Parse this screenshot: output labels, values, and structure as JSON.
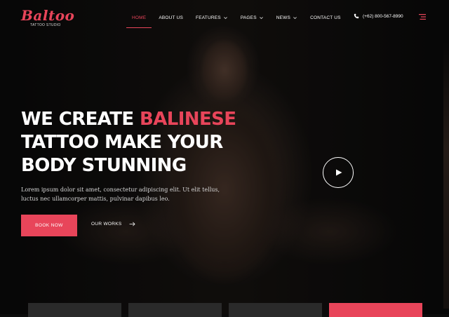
{
  "logo": {
    "title": "Baltoo",
    "subtitle": "TATTOO STUDIO"
  },
  "nav": {
    "items": [
      {
        "label": "HOME",
        "active": true,
        "dropdown": false
      },
      {
        "label": "ABOUT US",
        "active": false,
        "dropdown": false
      },
      {
        "label": "FEATURES",
        "active": false,
        "dropdown": true
      },
      {
        "label": "PAGES",
        "active": false,
        "dropdown": true
      },
      {
        "label": "NEWS",
        "active": false,
        "dropdown": true
      },
      {
        "label": "CONTACT US",
        "active": false,
        "dropdown": false
      }
    ]
  },
  "contact": {
    "phone": "(+62) 800-567-8990",
    "icon": "phone-icon"
  },
  "hero": {
    "headline_part1": "WE CREATE ",
    "headline_accent": "BALINESE",
    "headline_line2": "TATTOO MAKE YOUR",
    "headline_line3": "BODY STUNNING",
    "description": "Lorem ipsum dolor sit amet, consectetur adipiscing elit. Ut elit tellus, luctus nec ullamcorper mattis, pulvinar dapibus leo.",
    "primary_button": "BOOK NOW",
    "secondary_link": "OUR WORKS"
  },
  "colors": {
    "accent": "#e8455a",
    "background": "#0c0c0c",
    "text": "#ffffff"
  },
  "icons": [
    "phone-icon",
    "menu-icon",
    "chevron-down-icon",
    "arrow-right-icon",
    "play-icon"
  ]
}
